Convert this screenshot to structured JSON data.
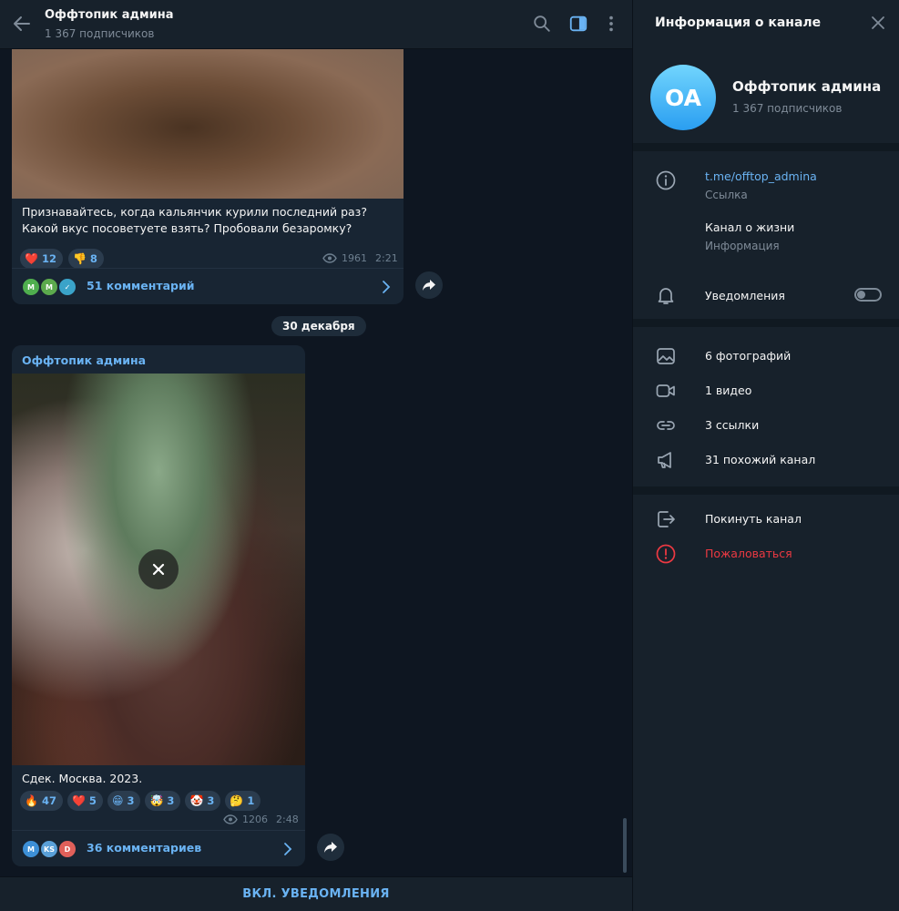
{
  "header": {
    "title": "Оффтопик админа",
    "subtitle": "1 367 подписчиков"
  },
  "post1": {
    "caption": "Признавайтесь, когда кальянчик курили последний раз? Какой вкус посоветуете взять? Пробовали безаромку?",
    "reactions": [
      {
        "emoji": "❤️",
        "count": "12"
      },
      {
        "emoji": "👎",
        "count": "8"
      }
    ],
    "views": "1961",
    "time": "2:21",
    "comment_avatars": [
      "M",
      "M",
      "✓"
    ],
    "comments_label": "51 комментарий"
  },
  "date_separator": "30 декабря",
  "post2": {
    "sender": "Оффтопик админа",
    "caption": "Сдек. Москва. 2023.",
    "reactions": [
      {
        "emoji": "🔥",
        "count": "47"
      },
      {
        "emoji": "❤️",
        "count": "5"
      },
      {
        "emoji": "😁",
        "count": "3"
      },
      {
        "emoji": "🤯",
        "count": "3"
      },
      {
        "emoji": "🤡",
        "count": "3"
      },
      {
        "emoji": "🤔",
        "count": "1"
      }
    ],
    "views": "1206",
    "time": "2:48",
    "comment_avatars": [
      "M",
      "KS",
      "D"
    ],
    "comments_label": "36 комментариев"
  },
  "bottom_bar": {
    "label": "ВКЛ. УВЕДОМЛЕНИЯ"
  },
  "panel": {
    "title": "Информация о канале",
    "avatar_initials": "OA",
    "name": "Оффтопик админа",
    "subscribers": "1 367 подписчиков",
    "link": "t.me/offtop_admina",
    "link_label": "Ссылка",
    "about": "Канал о жизни",
    "about_label": "Информация",
    "notifications": "Уведомления",
    "notifications_on": false,
    "media": {
      "photos": "6 фотографий",
      "videos": "1 видео",
      "links": "3 ссылки",
      "similar": "31 похожий канал"
    },
    "leave": "Покинуть канал",
    "report": "Пожаловаться"
  },
  "colors": {
    "accent": "#6ab3f3",
    "danger": "#ec3942",
    "panel_bg": "#17212b",
    "chat_bg": "#0e1621",
    "bubble_bg": "#182533"
  }
}
